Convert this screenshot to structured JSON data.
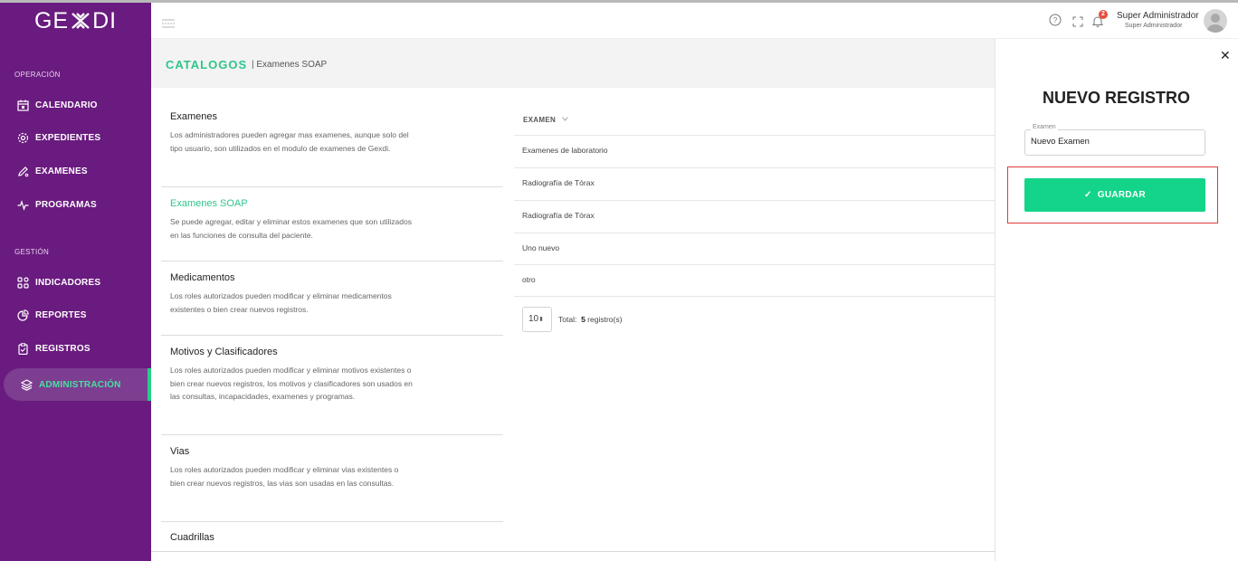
{
  "brand": {
    "logo_left": "GE",
    "logo_right": "DI"
  },
  "sidebar": {
    "section_operacion": "OPERACIÓN",
    "section_gestion": "GESTIÓN",
    "items": [
      {
        "label": "CALENDARIO",
        "icon": "calendar-icon"
      },
      {
        "label": "EXPEDIENTES",
        "icon": "gear-icon"
      },
      {
        "label": "EXAMENES",
        "icon": "pencil-icon"
      },
      {
        "label": "PROGRAMAS",
        "icon": "pulse-icon"
      },
      {
        "label": "INDICADORES",
        "icon": "grid-icon"
      },
      {
        "label": "REPORTES",
        "icon": "pie-chart-icon"
      },
      {
        "label": "REGISTROS",
        "icon": "clipboard-icon"
      },
      {
        "label": "ADMINISTRACIÓN",
        "icon": "layers-icon",
        "active": true
      }
    ],
    "accent_color": "#28cc8b",
    "bg_color": "#6a1b7f"
  },
  "header": {
    "notification_count": "2",
    "user_name": "Super Administrador",
    "user_role": "Super Administrador"
  },
  "breadcrumb": {
    "main": "CATALOGOS",
    "sub": "| Examenes SOAP"
  },
  "catalogs": [
    {
      "title": "Examenes",
      "desc": "Los administradores pueden agregar mas examenes, aunque solo del tipo usuario, son utilizados en el modulo de examenes de Gexdi."
    },
    {
      "title": "Examenes SOAP",
      "desc": "Se puede agregar, editar y eliminar estos examenes que son utilizados en las funciones de consulta del paciente.",
      "active": true
    },
    {
      "title": "Medicamentos",
      "desc": "Los roles autorizados pueden modificar y eliminar medicamentos existentes o bien crear nuevos registros."
    },
    {
      "title": "Motivos y Clasificadores",
      "desc": "Los roles autorizados pueden modificar y eliminar motivos existentes o bien crear nuevos registros, los motivos y clasificadores son usados en las consultas, incapacidades, examenes y programas."
    },
    {
      "title": "Vias",
      "desc": "Los roles autorizados pueden modificar y eliminar vias existentes o bien crear nuevos registros, las vias son usadas en las consultas."
    },
    {
      "title": "Cuadrillas",
      "desc": ""
    }
  ],
  "table": {
    "header": "EXAMEN",
    "rows": [
      "Examenes de laboratorio",
      "Radiografía de Tórax",
      "Radiografía de Tórax",
      "Uno nuevo",
      "otro"
    ],
    "page_size": "10",
    "total_label": "Total:",
    "total_value": "5",
    "total_suffix": "registro(s)"
  },
  "panel": {
    "title": "NUEVO REGISTRO",
    "field_label": "Examen",
    "field_value": "Nuevo Examen",
    "save_label": "GUARDAR",
    "button_color": "#14d48a",
    "highlight_color": "#e03b3b"
  }
}
